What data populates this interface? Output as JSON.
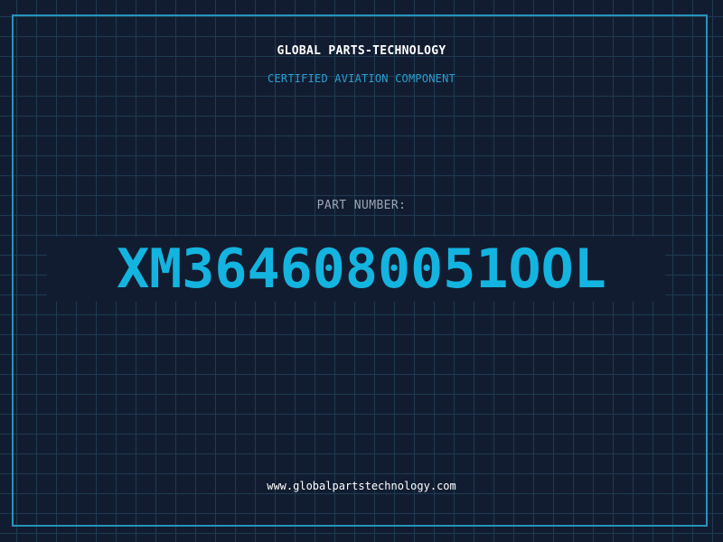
{
  "header": {
    "brand": "GLOBAL PARTS-TECHNOLOGY",
    "tagline": "CERTIFIED AVIATION COMPONENT"
  },
  "part": {
    "label": "PART NUMBER:",
    "number": "XM3646080051OOL"
  },
  "footer": {
    "website": "www.globalpartstechnology.com"
  },
  "colors": {
    "background": "#121c30",
    "grid": "#1d3b52",
    "frame": "#2494bd",
    "accent": "#14b4e0",
    "muted": "#9aa6b8",
    "text": "#ffffff"
  }
}
